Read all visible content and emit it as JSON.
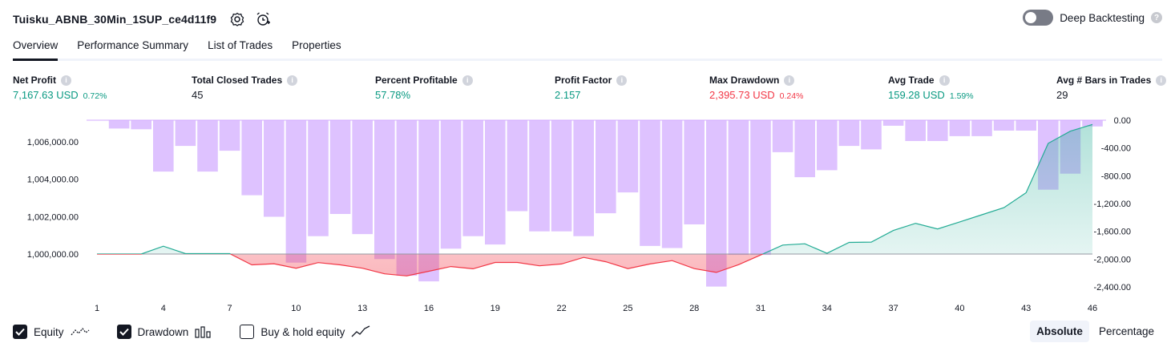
{
  "header": {
    "title": "Tuisku_ABNB_30Min_1SUP_ce4d11f9",
    "icons": [
      "settings-icon",
      "add-alert-icon"
    ],
    "deep_backtesting_label": "Deep Backtesting",
    "deep_backtesting_enabled": false,
    "help_glyph": "?"
  },
  "tabs": [
    {
      "label": "Overview",
      "active": true
    },
    {
      "label": "Performance Summary",
      "active": false
    },
    {
      "label": "List of Trades",
      "active": false
    },
    {
      "label": "Properties",
      "active": false
    }
  ],
  "stats": {
    "net_profit": {
      "label": "Net Profit",
      "value": "7,167.63 USD",
      "pct": "0.72%"
    },
    "total_closed_trades": {
      "label": "Total Closed Trades",
      "value": "45"
    },
    "percent_profitable": {
      "label": "Percent Profitable",
      "value": "57.78%"
    },
    "profit_factor": {
      "label": "Profit Factor",
      "value": "2.157"
    },
    "max_drawdown": {
      "label": "Max Drawdown",
      "value": "2,395.73 USD",
      "pct": "0.24%"
    },
    "avg_trade": {
      "label": "Avg Trade",
      "value": "159.28 USD",
      "pct": "1.59%"
    },
    "avg_bars": {
      "label": "Avg # Bars in Trades",
      "value": "29"
    }
  },
  "chart_data": {
    "type": "line",
    "x_ticks": [
      "1",
      "4",
      "7",
      "10",
      "13",
      "16",
      "19",
      "22",
      "25",
      "28",
      "31",
      "34",
      "37",
      "40",
      "43",
      "46"
    ],
    "left_axis_ticks": [
      "1,006,000.00",
      "1,004,000.00",
      "1,002,000.00",
      "1,000,000.00"
    ],
    "left_axis_values": [
      1006000,
      1004000,
      1002000,
      1000000
    ],
    "right_axis_ticks": [
      "0.00",
      "-400.00",
      "-800.00",
      "-1,200.00",
      "-1,600.00",
      "-2,000.00",
      "-2,400.00"
    ],
    "right_axis_values": [
      0,
      -400,
      -800,
      -1200,
      -1600,
      -2000,
      -2400
    ],
    "x": [
      1,
      2,
      3,
      4,
      5,
      6,
      7,
      8,
      9,
      10,
      11,
      12,
      13,
      14,
      15,
      16,
      17,
      18,
      19,
      20,
      21,
      22,
      23,
      24,
      25,
      26,
      27,
      28,
      29,
      30,
      31,
      32,
      33,
      34,
      35,
      36,
      37,
      38,
      39,
      40,
      41,
      42,
      43,
      44,
      45,
      46
    ],
    "series": [
      {
        "key": "equity",
        "values": [
          1000000,
          1000000,
          1000000,
          1000420,
          1000020,
          1000020,
          1000020,
          999420,
          999480,
          999240,
          999540,
          999420,
          999240,
          998940,
          998830,
          999080,
          999330,
          999210,
          999550,
          999550,
          999370,
          999470,
          999820,
          999590,
          999220,
          999470,
          999650,
          999220,
          999020,
          999430,
          999950,
          1000480,
          1000550,
          1000040,
          1000620,
          1000640,
          1001260,
          1001640,
          1001340,
          1001720,
          1002100,
          1002480,
          1003280,
          1005920,
          1006570,
          1006930
        ]
      },
      {
        "key": "drawdown",
        "values": [
          0,
          -120,
          -130,
          -740,
          -370,
          -740,
          -440,
          -1080,
          -1390,
          -2050,
          -1670,
          -1350,
          -1640,
          -2000,
          -2240,
          -2320,
          -1850,
          -1670,
          -1790,
          -1310,
          -1600,
          -1600,
          -1670,
          -1340,
          -1040,
          -1810,
          -1840,
          -1500,
          -2395,
          -1940,
          -1940,
          -460,
          -820,
          -720,
          -370,
          -420,
          -80,
          -300,
          -300,
          -230,
          -230,
          -150,
          -150,
          -1000,
          -770,
          -90
        ]
      }
    ],
    "colors": {
      "equity_up": "#22ab94",
      "equity_down": "#f23645",
      "drawdown": "#d1aaff",
      "text": "#131722"
    }
  },
  "legend": [
    {
      "label": "Equity",
      "checked": true,
      "icon": "equity-line-icon"
    },
    {
      "label": "Drawdown",
      "checked": true,
      "icon": "drawdown-bars-icon"
    },
    {
      "label": "Buy & hold equity",
      "checked": false,
      "icon": "buy-hold-line-icon"
    }
  ],
  "mode": {
    "absolute": "Absolute",
    "percentage": "Percentage",
    "active": "absolute"
  }
}
